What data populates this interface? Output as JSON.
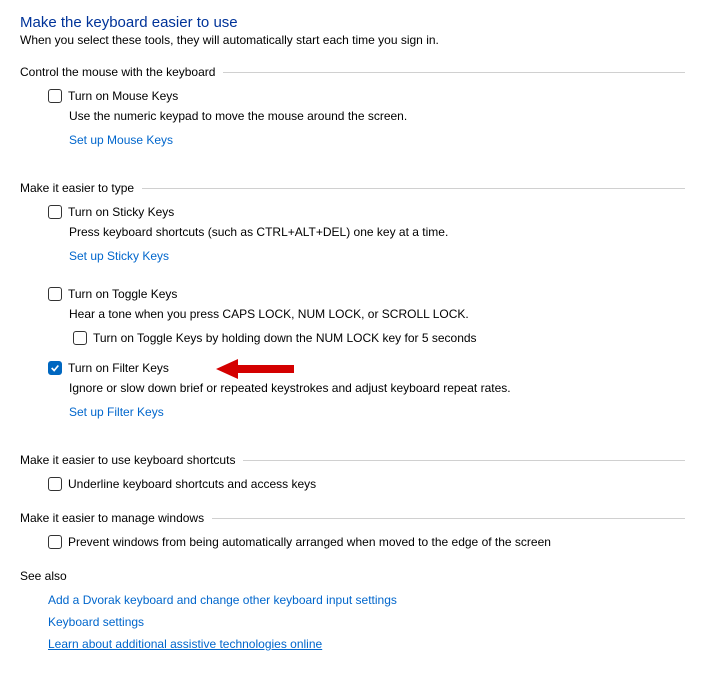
{
  "title": "Make the keyboard easier to use",
  "subtitle": "When you select these tools, they will automatically start each time you sign in.",
  "sections": {
    "mouse": {
      "title": "Control the mouse with the keyboard",
      "mouseKeys": {
        "label": "Turn on Mouse Keys",
        "checked": false
      },
      "desc": "Use the numeric keypad to move the mouse around the screen.",
      "link": "Set up Mouse Keys"
    },
    "type": {
      "title": "Make it easier to type",
      "stickyKeys": {
        "label": "Turn on Sticky Keys",
        "checked": false
      },
      "stickyDesc": "Press keyboard shortcuts (such as CTRL+ALT+DEL) one key at a time.",
      "stickyLink": "Set up Sticky Keys",
      "toggleKeys": {
        "label": "Turn on Toggle Keys",
        "checked": false
      },
      "toggleDesc": "Hear a tone when you press CAPS LOCK, NUM LOCK, or SCROLL LOCK.",
      "toggleHold": {
        "label": "Turn on Toggle Keys by holding down the NUM LOCK key for 5 seconds",
        "checked": false
      },
      "filterKeys": {
        "label": "Turn on Filter Keys",
        "checked": true
      },
      "filterDesc": "Ignore or slow down brief or repeated keystrokes and adjust keyboard repeat rates.",
      "filterLink": "Set up Filter Keys"
    },
    "shortcuts": {
      "title": "Make it easier to use keyboard shortcuts",
      "underline": {
        "label": "Underline keyboard shortcuts and access keys",
        "checked": false
      }
    },
    "windows": {
      "title": "Make it easier to manage windows",
      "prevent": {
        "label": "Prevent windows from being automatically arranged when moved to the edge of the screen",
        "checked": false
      }
    }
  },
  "seeAlso": {
    "title": "See also",
    "links": {
      "dvorak": "Add a Dvorak keyboard and change other keyboard input settings",
      "kbSettings": "Keyboard settings",
      "assistive": "Learn about additional assistive technologies online"
    }
  },
  "arrowColor": "#d40000"
}
